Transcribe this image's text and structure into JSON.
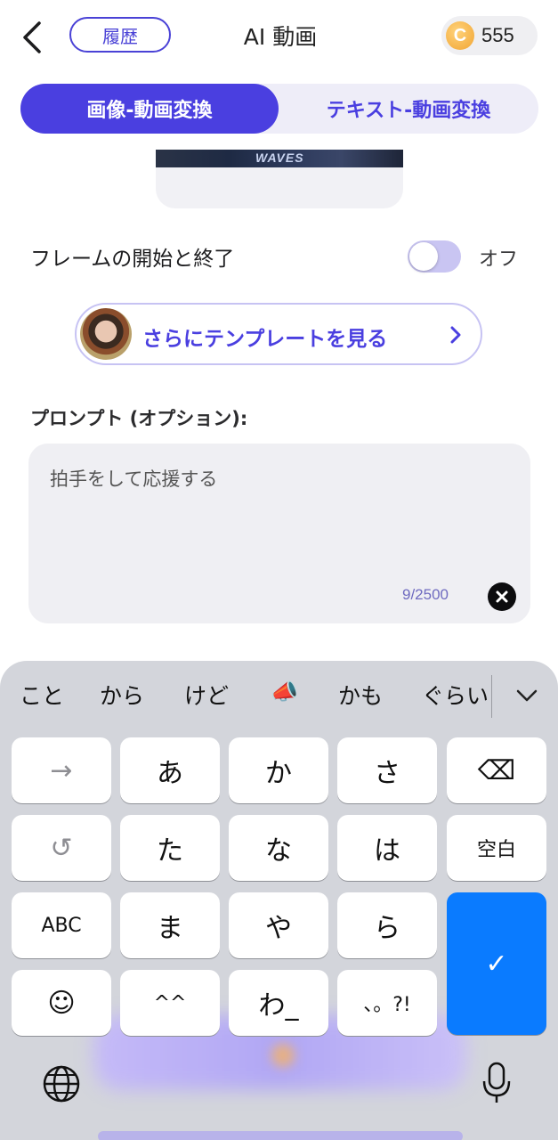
{
  "header": {
    "back_icon": "chevron-left-icon",
    "history_label": "履歴",
    "title": "AI 動画",
    "coin_symbol": "C",
    "coin_count": "555"
  },
  "tabs": [
    {
      "label": "画像-動画変換",
      "active": true
    },
    {
      "label": "テキスト-動画変換",
      "active": false
    }
  ],
  "image_card": {
    "jersey_text": "WAVES"
  },
  "frames": {
    "label": "フレームの開始と終了",
    "state_label": "オフ",
    "enabled": false
  },
  "template": {
    "label": "さらにテンプレートを見る",
    "chevron_icon": "chevron-right-icon"
  },
  "prompt": {
    "label": "プロンプト (オプション):",
    "text": "拍手をして応援する",
    "char_count": "9/2500",
    "clear_icon": "close-circle-icon"
  },
  "keyboard": {
    "candidates": [
      "こと",
      "から",
      "けど",
      "📣",
      "かも",
      "ぐらい"
    ],
    "collapse_icon": "chevron-down-icon",
    "rows": [
      [
        "→",
        "あ",
        "か",
        "さ",
        "⌫"
      ],
      [
        "↺",
        "た",
        "な",
        "は",
        "空白"
      ],
      [
        "ABC",
        "ま",
        "や",
        "ら"
      ],
      [
        "☺",
        "^^",
        "わ_",
        "、。?!"
      ]
    ],
    "enter_symbol": "✓",
    "globe_icon": "globe-icon",
    "mic_icon": "microphone-icon"
  },
  "colors": {
    "accent": "#4a3fe0",
    "enter_key": "#0a7bff",
    "keyboard_bg": "#d3d5db"
  }
}
